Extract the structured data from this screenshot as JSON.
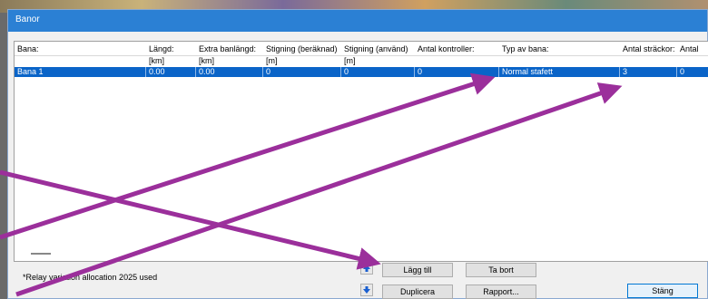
{
  "window": {
    "title": "Banor"
  },
  "table": {
    "headers": [
      "Bana:",
      "Längd:",
      "Extra banlängd:",
      "Stigning (beräknad)",
      "Stigning (använd)",
      "Antal kontroller:",
      "Typ av bana:",
      "Antal sträckor:",
      "Antal"
    ],
    "units": [
      "",
      "[km]",
      "[km]",
      "[m]",
      "[m]",
      "",
      "",
      "",
      ""
    ],
    "rows": [
      [
        "Bana 1",
        "0.00",
        "0.00",
        "0",
        "0",
        "0",
        "Normal stafett",
        "3",
        "0"
      ]
    ]
  },
  "footer": {
    "note": "*Relay variation allocation 2025 used",
    "buttons": {
      "add": "Lägg till",
      "delete": "Ta bort",
      "duplicate": "Duplicera",
      "report": "Rapport...",
      "close": "Stäng"
    }
  },
  "annotation_color": "#9b2f9b"
}
